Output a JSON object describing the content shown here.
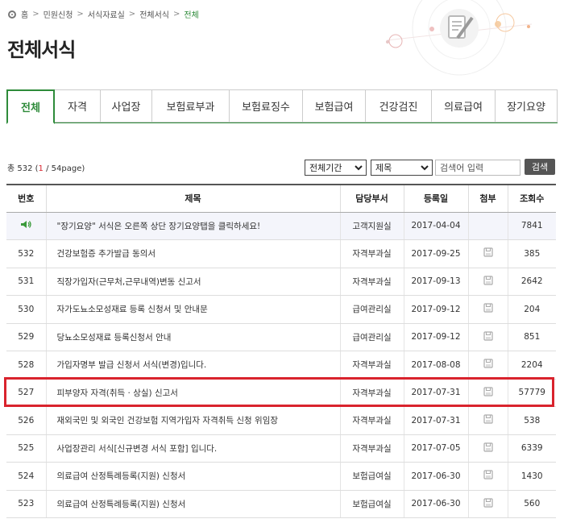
{
  "breadcrumb": {
    "items": [
      "홈",
      "민원신청",
      "서식자료실",
      "전체서식",
      "전체"
    ],
    "separator": ">"
  },
  "page_title": "전체서식",
  "tabs": [
    {
      "label": "전체",
      "active": true
    },
    {
      "label": "자격",
      "active": false
    },
    {
      "label": "사업장",
      "active": false
    },
    {
      "label": "보험료부과",
      "active": false
    },
    {
      "label": "보험료징수",
      "active": false
    },
    {
      "label": "보험급여",
      "active": false
    },
    {
      "label": "건강검진",
      "active": false
    },
    {
      "label": "의료급여",
      "active": false
    },
    {
      "label": "장기요양",
      "active": false
    }
  ],
  "list_info": {
    "prefix": "총 532 (",
    "current_page": "1",
    "suffix": " / 54page)"
  },
  "filters": {
    "period": "전체기간",
    "field": "제목",
    "search_placeholder": "검색어 입력",
    "search_button": "검색"
  },
  "table": {
    "headers": [
      "번호",
      "제목",
      "담당부서",
      "등록일",
      "첨부",
      "조회수"
    ],
    "rows": [
      {
        "no": "",
        "title": "\"장기요양\" 서식은 오른쪽 상단 장기요양탭을 클릭하세요!",
        "dept": "고객지원실",
        "date": "2017-04-04",
        "views": "7841",
        "notice": true,
        "attach": false
      },
      {
        "no": "532",
        "title": "건강보험증 추가발급 동의서",
        "dept": "자격부과실",
        "date": "2017-09-25",
        "views": "385",
        "notice": false,
        "attach": true
      },
      {
        "no": "531",
        "title": "직장가입자(근무처,근무내역)변동 신고서",
        "dept": "자격부과실",
        "date": "2017-09-13",
        "views": "2642",
        "notice": false,
        "attach": true
      },
      {
        "no": "530",
        "title": "자가도뇨소모성재료 등록 신청서 및 안내문",
        "dept": "급여관리실",
        "date": "2017-09-12",
        "views": "204",
        "notice": false,
        "attach": true
      },
      {
        "no": "529",
        "title": "당뇨소모성재료 등록신청서 안내",
        "dept": "급여관리실",
        "date": "2017-09-12",
        "views": "851",
        "notice": false,
        "attach": true
      },
      {
        "no": "528",
        "title": "가입자명부 발급 신청서 서식(변경)입니다.",
        "dept": "자격부과실",
        "date": "2017-08-08",
        "views": "2204",
        "notice": false,
        "attach": true
      },
      {
        "no": "527",
        "title": "피부양자 자격(취득 · 상실) 신고서",
        "dept": "자격부과실",
        "date": "2017-07-31",
        "views": "57779",
        "notice": false,
        "attach": true
      },
      {
        "no": "526",
        "title": "재외국민 및 외국인 건강보험 지역가입자 자격취득 신청 위임장",
        "dept": "자격부과실",
        "date": "2017-07-31",
        "views": "538",
        "notice": false,
        "attach": true
      },
      {
        "no": "525",
        "title": "사업장관리 서식[신규변경 서식 포함] 입니다.",
        "dept": "자격부과실",
        "date": "2017-07-05",
        "views": "6339",
        "notice": false,
        "attach": true
      },
      {
        "no": "524",
        "title": "의료급여 산정특례등록(지원) 신청서",
        "dept": "보험급여실",
        "date": "2017-06-30",
        "views": "1430",
        "notice": false,
        "attach": true
      },
      {
        "no": "523",
        "title": "의료급여 산정특례등록(지원) 신청서",
        "dept": "보험급여실",
        "date": "2017-06-30",
        "views": "560",
        "notice": false,
        "attach": true
      }
    ]
  },
  "colors": {
    "accent": "#2e8b3a",
    "highlight": "#d9232d",
    "notice_bg": "#f4f5fb"
  },
  "icons": {
    "notice": "speaker-icon",
    "attachment": "file-icon",
    "home": "home-icon"
  }
}
